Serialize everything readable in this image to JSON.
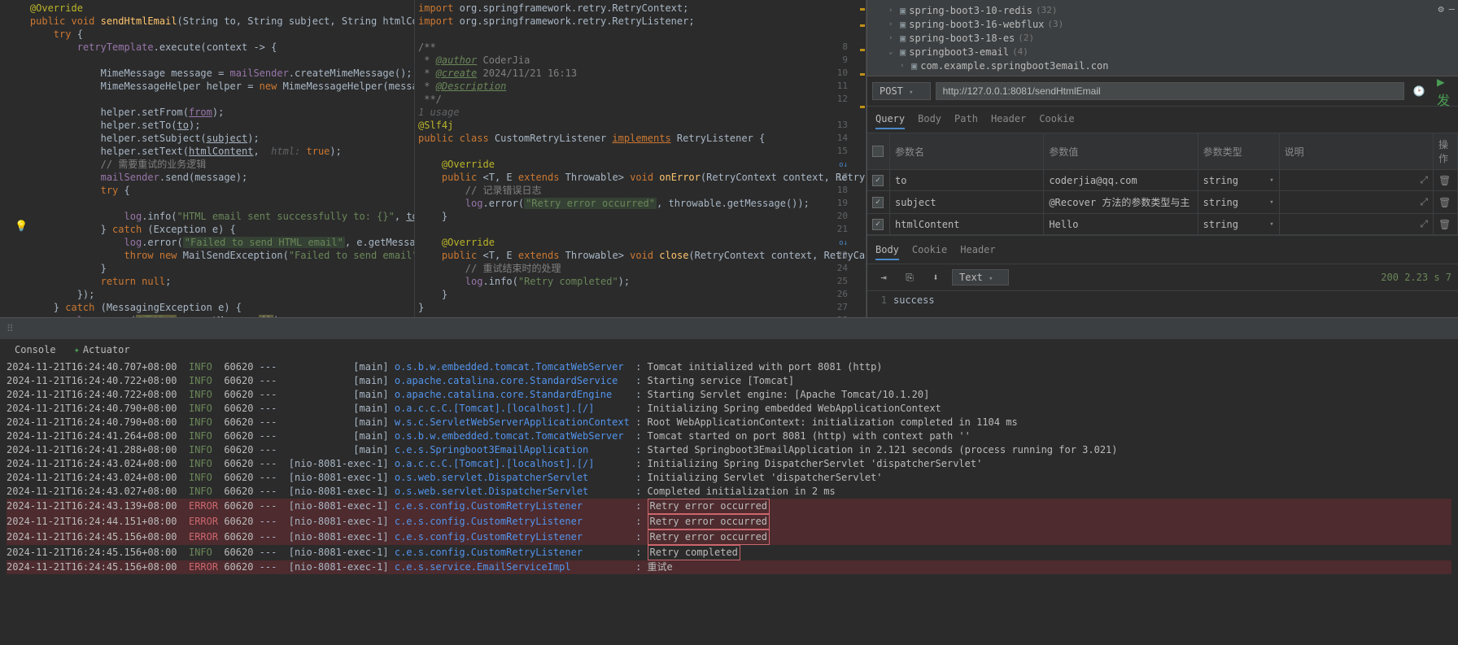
{
  "editor_left": {
    "lines": [
      {
        "t": "@Override",
        "cls": "annot",
        "indent": 1
      },
      {
        "raw": "<span class='kw'>public void</span> <span class='method'>sendHtmlEmail</span>(String to, String subject, String htmlContent) {",
        "indent": 1
      },
      {
        "raw": "<span class='kw'>try</span> {",
        "indent": 2
      },
      {
        "raw": "<span class='field'>retryTemplate</span>.execute(context -> {",
        "indent": 3
      },
      {
        "t": "",
        "indent": 0
      },
      {
        "raw": "MimeMessage message = <span class='field'>mailSender</span>.createMimeMessage();",
        "indent": 4
      },
      {
        "raw": "MimeMessageHelper helper = <span class='kw'>new</span> MimeMessageHelper(message,  <span class='hint'>multipart</span>",
        "indent": 4
      },
      {
        "t": "",
        "indent": 0
      },
      {
        "raw": "helper.setFrom(<span class='field underline'>from</span>);",
        "indent": 4
      },
      {
        "raw": "helper.setTo(<span class='underline'>to</span>);",
        "indent": 4
      },
      {
        "raw": "helper.setSubject(<span class='underline'>subject</span>);",
        "indent": 4
      },
      {
        "raw": "helper.setText(<span class='underline'>htmlContent</span>,  <span class='hint'>html:</span> <span class='kw'>true</span>);",
        "indent": 4
      },
      {
        "raw": "<span class='comment'>// 需要重试的业务逻辑</span>",
        "indent": 4
      },
      {
        "raw": "<span class='field'>mailSender</span>.send(message);",
        "indent": 4
      },
      {
        "raw": "<span class='kw'>try</span> {",
        "indent": 4
      },
      {
        "t": "",
        "indent": 0
      },
      {
        "raw": "<span class='field'>log</span>.info(<span class='str'>\"HTML email sent successfully to: {}\"</span>, <span class='underline'>to</span>);",
        "indent": 5
      },
      {
        "raw": "} <span class='kw'>catch</span> (Exception e) {",
        "indent": 4
      },
      {
        "raw": "<span class='field'>log</span>.error(<span class='highlight-box str'>\"Failed to send HTML email\"</span>, e.getMessage());",
        "indent": 5
      },
      {
        "raw": "<span class='kw'>throw new</span> MailSendException(<span class='str'>\"Failed to send email\"</span>, e);",
        "indent": 5
      },
      {
        "t": "}",
        "indent": 4
      },
      {
        "raw": "<span class='kw'>return null</span>;",
        "indent": 4
      },
      {
        "t": "});",
        "indent": 3
      },
      {
        "raw": "} <span class='kw'>catch</span> (MessagingException e) {",
        "indent": 2
      },
      {
        "raw": "<span class='field'>log</span>.error(<span class='highlight-yellow str'>\"重试e\"</span>, e.getMessage<span class='highlight-yellow'>()</span>);",
        "indent": 3
      },
      {
        "t": "}",
        "indent": 2
      },
      {
        "t": "",
        "indent": 0
      },
      {
        "t": "",
        "indent": 0
      },
      {
        "t": "}",
        "indent": 1
      },
      {
        "t": "",
        "indent": 0
      },
      {
        "raw": "<span class='comment'>/**</span>",
        "indent": 1
      }
    ]
  },
  "editor_right": {
    "gutter_start": 8,
    "lines": [
      {
        "raw": "<span class='kw'>import</span> org.springframework.retry.RetryContext;",
        "num": ""
      },
      {
        "raw": "<span class='kw'>import</span> org.springframework.retry.RetryListener;",
        "num": ""
      },
      {
        "t": "",
        "num": ""
      },
      {
        "raw": "<span class='comment'>/**</span>",
        "num": "8"
      },
      {
        "raw": "<span class='comment'> * </span><span class='doctag underline'>@author</span><span class='comment'> CoderJia</span>",
        "num": "9"
      },
      {
        "raw": "<span class='comment'> * </span><span class='doctag underline'>@create</span><span class='comment'> 2024/11/21 16:13</span>",
        "num": "10"
      },
      {
        "raw": "<span class='comment'> * </span><span class='doctag underline'>@Description</span>",
        "num": "11"
      },
      {
        "raw": "<span class='comment'> **/</span>",
        "num": "12"
      },
      {
        "raw": "<span class='hint'>1 usage</span>",
        "num": ""
      },
      {
        "raw": "<span class='annot'>@Slf4j</span>",
        "num": "13"
      },
      {
        "raw": "<span class='kw'>public class</span> CustomRetryListener <span class='kw underline'>implements</span> RetryListener {",
        "num": "14"
      },
      {
        "t": "",
        "num": "15"
      },
      {
        "raw": "    <span class='annot'>@Override</span>",
        "num": "16",
        "icon": "o↓"
      },
      {
        "raw": "    <span class='kw'>public</span> &lt;<span class='type'>T</span>, <span class='type'>E</span> <span class='kw'>extends</span> Throwable&gt; <span class='kw'>void</span> <span class='method'>onError</span>(RetryContext context, RetryCall",
        "num": "17"
      },
      {
        "raw": "        <span class='comment'>// 记录错误日志</span>",
        "num": "18"
      },
      {
        "raw": "        <span class='field'>log</span>.error(<span class='highlight-box str'>\"Retry error occurred\"</span>, throwable.getMessage());",
        "num": "19"
      },
      {
        "raw": "    }",
        "num": "20"
      },
      {
        "t": "",
        "num": "21"
      },
      {
        "raw": "    <span class='annot'>@Override</span>",
        "num": "22",
        "icon": "o↓"
      },
      {
        "raw": "    <span class='kw'>public</span> &lt;<span class='type'>T</span>, <span class='type'>E</span> <span class='kw'>extends</span> Throwable&gt; <span class='kw'>void</span> <span class='method'>close</span>(RetryContext context, RetryCallba",
        "num": "23"
      },
      {
        "raw": "        <span class='comment'>// 重试结束时的处理</span>",
        "num": "24"
      },
      {
        "raw": "        <span class='field'>log</span>.info(<span class='str'>\"Retry completed\"</span>);",
        "num": "25"
      },
      {
        "raw": "    }",
        "num": "26"
      },
      {
        "raw": "}",
        "num": "27"
      },
      {
        "t": "",
        "num": "28"
      }
    ]
  },
  "project_tree": [
    {
      "indent": 1,
      "expand": "›",
      "name": "spring-boot3-10-redis",
      "count": "(32)"
    },
    {
      "indent": 1,
      "expand": "›",
      "name": "spring-boot3-16-webflux",
      "count": "(3)"
    },
    {
      "indent": 1,
      "expand": "›",
      "name": "spring-boot3-18-es",
      "count": "(2)"
    },
    {
      "indent": 1,
      "expand": "⌄",
      "name": "springboot3-email",
      "count": "(4)"
    },
    {
      "indent": 2,
      "expand": "›",
      "name": "com.example.springboot3email.con",
      "count": ""
    }
  ],
  "rest": {
    "method": "POST",
    "url": "http://127.0.0.1:8081/sendHtmlEmail",
    "req_tabs": [
      "Query",
      "Body",
      "Path",
      "Header",
      "Cookie"
    ],
    "req_tab_active": "Query",
    "param_headers": {
      "name": "参数名",
      "value": "参数值",
      "type": "参数类型",
      "desc": "说明",
      "op": "操作"
    },
    "params": [
      {
        "name": "to",
        "value": "coderjia@qq.com",
        "type": "string"
      },
      {
        "name": "subject",
        "value": "@Recover 方法的参数类型与主",
        "type": "string"
      },
      {
        "name": "htmlContent",
        "value": "<h>Hello</h>",
        "type": "string"
      }
    ],
    "resp_tabs": [
      "Body",
      "Cookie",
      "Header"
    ],
    "resp_tab_active": "Body",
    "resp_format": "Text",
    "resp_status": "200 2.23 s  7",
    "resp_body": "success"
  },
  "console": {
    "tabs": {
      "console": "Console",
      "actuator": "Actuator"
    },
    "lines": [
      {
        "ts": "2024-11-21T16:24:40.707+08:00",
        "lvl": "INFO",
        "pid": "60620",
        "thr": "main",
        "logger": "o.s.b.w.embedded.tomcat.TomcatWebServer",
        "msg": "Tomcat initialized with port 8081 (http)"
      },
      {
        "ts": "2024-11-21T16:24:40.722+08:00",
        "lvl": "INFO",
        "pid": "60620",
        "thr": "main",
        "logger": "o.apache.catalina.core.StandardService",
        "msg": "Starting service [Tomcat]"
      },
      {
        "ts": "2024-11-21T16:24:40.722+08:00",
        "lvl": "INFO",
        "pid": "60620",
        "thr": "main",
        "logger": "o.apache.catalina.core.StandardEngine",
        "msg": "Starting Servlet engine: [Apache Tomcat/10.1.20]"
      },
      {
        "ts": "2024-11-21T16:24:40.790+08:00",
        "lvl": "INFO",
        "pid": "60620",
        "thr": "main",
        "logger": "o.a.c.c.C.[Tomcat].[localhost].[/]",
        "msg": "Initializing Spring embedded WebApplicationContext"
      },
      {
        "ts": "2024-11-21T16:24:40.790+08:00",
        "lvl": "INFO",
        "pid": "60620",
        "thr": "main",
        "logger": "w.s.c.ServletWebServerApplicationContext",
        "msg": "Root WebApplicationContext: initialization completed in 1104 ms"
      },
      {
        "ts": "2024-11-21T16:24:41.264+08:00",
        "lvl": "INFO",
        "pid": "60620",
        "thr": "main",
        "logger": "o.s.b.w.embedded.tomcat.TomcatWebServer",
        "msg": "Tomcat started on port 8081 (http) with context path ''"
      },
      {
        "ts": "2024-11-21T16:24:41.288+08:00",
        "lvl": "INFO",
        "pid": "60620",
        "thr": "main",
        "logger": "c.e.s.Springboot3EmailApplication",
        "msg": "Started Springboot3EmailApplication in 2.121 seconds (process running for 3.021)"
      },
      {
        "ts": "2024-11-21T16:24:43.024+08:00",
        "lvl": "INFO",
        "pid": "60620",
        "thr": "nio-8081-exec-1",
        "logger": "o.a.c.c.C.[Tomcat].[localhost].[/]",
        "msg": "Initializing Spring DispatcherServlet 'dispatcherServlet'"
      },
      {
        "ts": "2024-11-21T16:24:43.024+08:00",
        "lvl": "INFO",
        "pid": "60620",
        "thr": "nio-8081-exec-1",
        "logger": "o.s.web.servlet.DispatcherServlet",
        "msg": "Initializing Servlet 'dispatcherServlet'"
      },
      {
        "ts": "2024-11-21T16:24:43.027+08:00",
        "lvl": "INFO",
        "pid": "60620",
        "thr": "nio-8081-exec-1",
        "logger": "o.s.web.servlet.DispatcherServlet",
        "msg": "Completed initialization in 2 ms"
      },
      {
        "ts": "2024-11-21T16:24:43.139+08:00",
        "lvl": "ERROR",
        "pid": "60620",
        "thr": "nio-8081-exec-1",
        "logger": "c.e.s.config.CustomRetryListener",
        "msg": "Retry error occurred",
        "boxed": true,
        "err": true
      },
      {
        "ts": "2024-11-21T16:24:44.151+08:00",
        "lvl": "ERROR",
        "pid": "60620",
        "thr": "nio-8081-exec-1",
        "logger": "c.e.s.config.CustomRetryListener",
        "msg": "Retry error occurred",
        "boxed": true,
        "err": true
      },
      {
        "ts": "2024-11-21T16:24:45.156+08:00",
        "lvl": "ERROR",
        "pid": "60620",
        "thr": "nio-8081-exec-1",
        "logger": "c.e.s.config.CustomRetryListener",
        "msg": "Retry error occurred",
        "boxed": true,
        "err": true
      },
      {
        "ts": "2024-11-21T16:24:45.156+08:00",
        "lvl": "INFO",
        "pid": "60620",
        "thr": "nio-8081-exec-1",
        "logger": "c.e.s.config.CustomRetryListener",
        "msg": "Retry completed",
        "boxed": true
      },
      {
        "ts": "2024-11-21T16:24:45.156+08:00",
        "lvl": "ERROR",
        "pid": "60620",
        "thr": "nio-8081-exec-1",
        "logger": "c.e.s.service.EmailServiceImpl",
        "msg": "重试e",
        "err": true
      }
    ]
  }
}
